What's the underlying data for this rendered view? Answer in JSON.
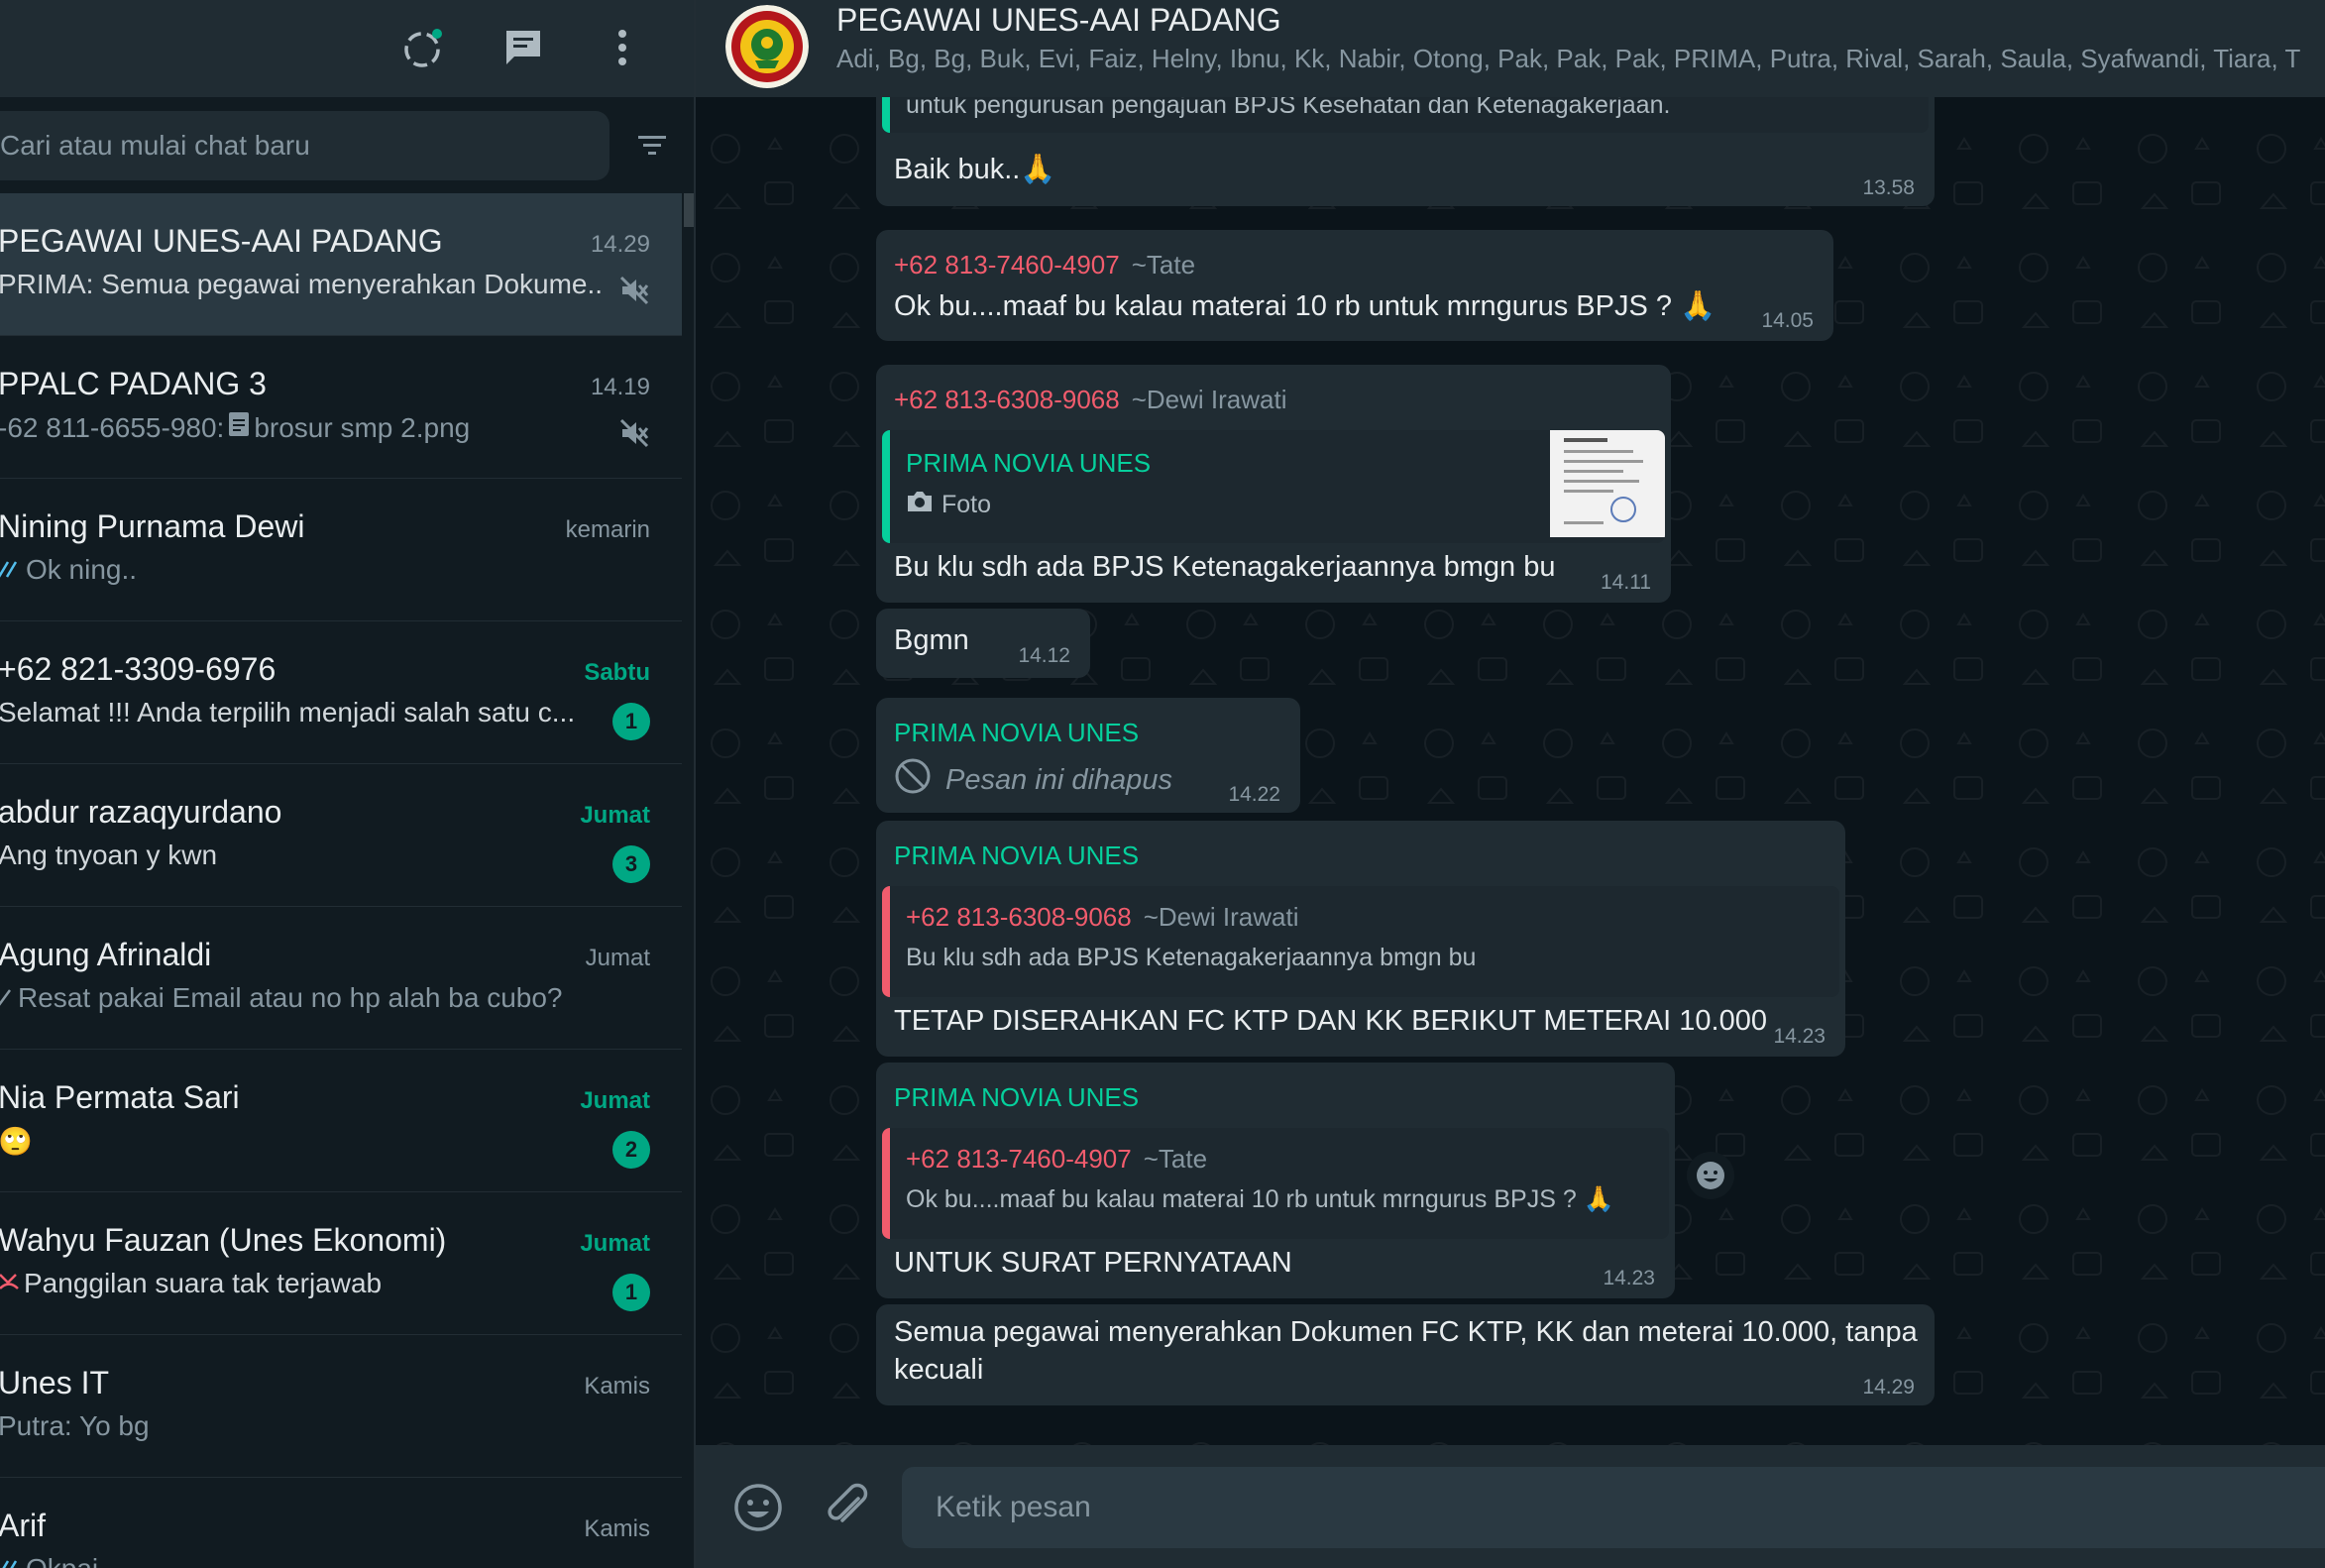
{
  "sidebar": {
    "search_placeholder": "Cari atau mulai chat baru",
    "icons": [
      "status-icon",
      "new-chat-icon",
      "menu-icon",
      "filter-icon"
    ],
    "chats": [
      {
        "name": "PEGAWAI UNES-AAI PADANG",
        "time": "14.29",
        "preview": "PRIMA: Semua pegawai menyerahkan Dokume...",
        "muted": true,
        "active": true
      },
      {
        "name": "PPALC PADANG 3",
        "time": "14.19",
        "preview_prefix": "-62 811-6655-980:",
        "preview": "brosur smp 2.png",
        "muted": true
      },
      {
        "name": "Nining Purnama Dewi",
        "time": "kemarin",
        "preview": "Ok ning..",
        "read_ticks": true
      },
      {
        "name": "+62 821-3309-6976",
        "time": "Sabtu",
        "preview": "Selamat !!! Anda terpilih menjadi salah satu c...",
        "unread": "1"
      },
      {
        "name": "abdur razaqyurdano",
        "time": "Jumat",
        "preview": "Ang tnyoan y kwn",
        "unread": "3"
      },
      {
        "name": "Agung Afrinaldi",
        "time": "Jumat",
        "preview": "Resat pakai Email atau no hp alah ba cubo?",
        "sent_tick": true
      },
      {
        "name": "Nia Permata Sari",
        "time": "Jumat",
        "preview": "🙄",
        "unread": "2"
      },
      {
        "name": "Wahyu Fauzan (Unes Ekonomi)",
        "time": "Jumat",
        "preview": "Panggilan suara tak terjawab",
        "unread": "1",
        "missed_call": true
      },
      {
        "name": "Unes IT",
        "time": "Kamis",
        "preview": "Putra: Yo bg"
      },
      {
        "name": "Arif",
        "time": "Kamis",
        "preview": "Okpai"
      }
    ]
  },
  "chat": {
    "title": "PEGAWAI UNES-AAI PADANG",
    "members": "Adi, Bg, Bg, Buk, Evi, Faiz, Helny, Ibnu, Kk, Nabir, Otong, Pak, Pak, Pak, PRIMA, Putra, Rival, Sarah, Saula, Syafwandi, Tiara, T",
    "messages": [
      {
        "quote_tail": "untuk pengurusan pengajuan BPJS Kesehatan dan Ketenagakerjaan.",
        "text": "Baik buk..🙏",
        "time": "13.58"
      },
      {
        "sender": "+62 813-7460-4907",
        "alias": "~Tate",
        "text": "Ok bu....maaf bu kalau materai 10 rb untuk mrngurus BPJS ? 🙏",
        "time": "14.05"
      },
      {
        "sender": "+62 813-6308-9068",
        "alias": "~Dewi Irawati",
        "quote_sender": "PRIMA NOVIA UNES",
        "quote_text": "Foto",
        "text": "Bu klu sdh ada BPJS Ketenagakerjaannya bmgn bu",
        "time": "14.11"
      },
      {
        "text": "Bgmn",
        "time": "14.12"
      },
      {
        "sender": "PRIMA NOVIA UNES",
        "text": "Pesan ini dihapus",
        "time": "14.22",
        "deleted": true
      },
      {
        "sender": "PRIMA NOVIA UNES",
        "quote_sender": "+62 813-6308-9068",
        "quote_alias": "~Dewi Irawati",
        "quote_text": "Bu klu sdh ada BPJS Ketenagakerjaannya bmgn bu",
        "text": "TETAP DISERAHKAN FC KTP DAN KK BERIKUT METERAI 10.000",
        "time": "14.23"
      },
      {
        "sender": "PRIMA NOVIA UNES",
        "quote_sender": "+62 813-7460-4907",
        "quote_alias": "~Tate",
        "quote_text": "Ok bu....maaf bu kalau materai 10 rb untuk mrngurus BPJS ? 🙏",
        "text": "UNTUK SURAT PERNYATAAN",
        "time": "14.23"
      },
      {
        "text_line1": "Semua pegawai menyerahkan Dokumen FC KTP, KK dan meterai 10.000, tanpa",
        "text_line2": "kecuali",
        "time": "14.29"
      }
    ]
  },
  "composer": {
    "placeholder": "Ketik pesan"
  },
  "colors": {
    "accent": "#00a884",
    "bubble": "#202c33",
    "panel": "#111b21",
    "sender_red": "#f15c6d",
    "sender_green": "#06cf9c"
  }
}
